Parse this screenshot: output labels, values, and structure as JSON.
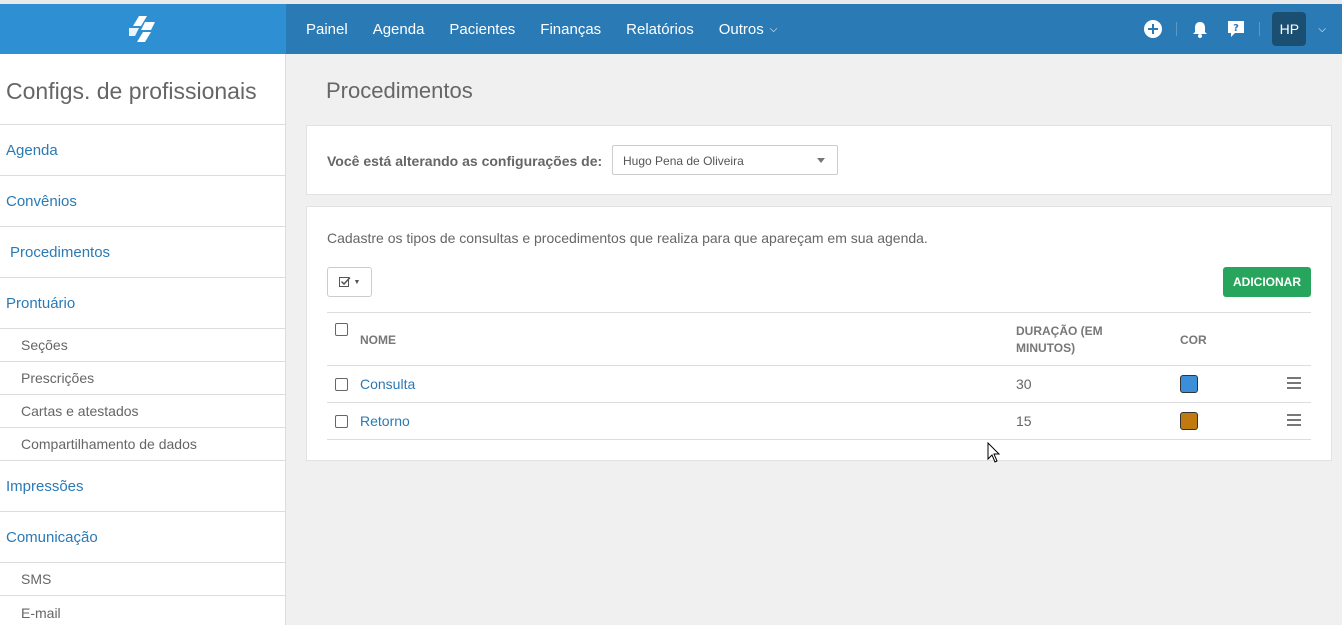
{
  "nav": {
    "items": [
      "Painel",
      "Agenda",
      "Pacientes",
      "Finanças",
      "Relatórios",
      "Outros"
    ],
    "user_initials": "HP"
  },
  "sidebar": {
    "title": "Configs. de profissionais",
    "items": [
      {
        "label": "Agenda",
        "type": "main"
      },
      {
        "label": "Convênios",
        "type": "main"
      },
      {
        "label": "Procedimentos",
        "type": "main"
      },
      {
        "label": "Prontuário",
        "type": "main"
      },
      {
        "label": "Seções",
        "type": "sub"
      },
      {
        "label": "Prescrições",
        "type": "sub"
      },
      {
        "label": "Cartas e atestados",
        "type": "sub"
      },
      {
        "label": "Compartilhamento de dados",
        "type": "sub"
      },
      {
        "label": "Impressões",
        "type": "main"
      },
      {
        "label": "Comunicação",
        "type": "main"
      },
      {
        "label": "SMS",
        "type": "sub"
      },
      {
        "label": "E-mail",
        "type": "sub"
      }
    ]
  },
  "main": {
    "title": "Procedimentos",
    "config_label": "Você está alterando as configurações de:",
    "professional_select": "Hugo Pena de Oliveira",
    "description": "Cadastre os tipos de consultas e procedimentos que realiza para que apareçam em sua agenda.",
    "add_button": "ADICIONAR",
    "table": {
      "headers": {
        "name": "NOME",
        "duration_line1": "DURAÇÃO (EM",
        "duration_line2": "MINUTOS)",
        "color": "COR"
      },
      "rows": [
        {
          "name": "Consulta",
          "duration": "30",
          "color": "#3a8fd8"
        },
        {
          "name": "Retorno",
          "duration": "15",
          "color": "#c07a10"
        }
      ]
    }
  },
  "colors": {
    "topbar": "#2a7ab5",
    "logo_bg": "#2e8fd3",
    "link": "#2a7ab5",
    "add_button": "#27a55c"
  }
}
